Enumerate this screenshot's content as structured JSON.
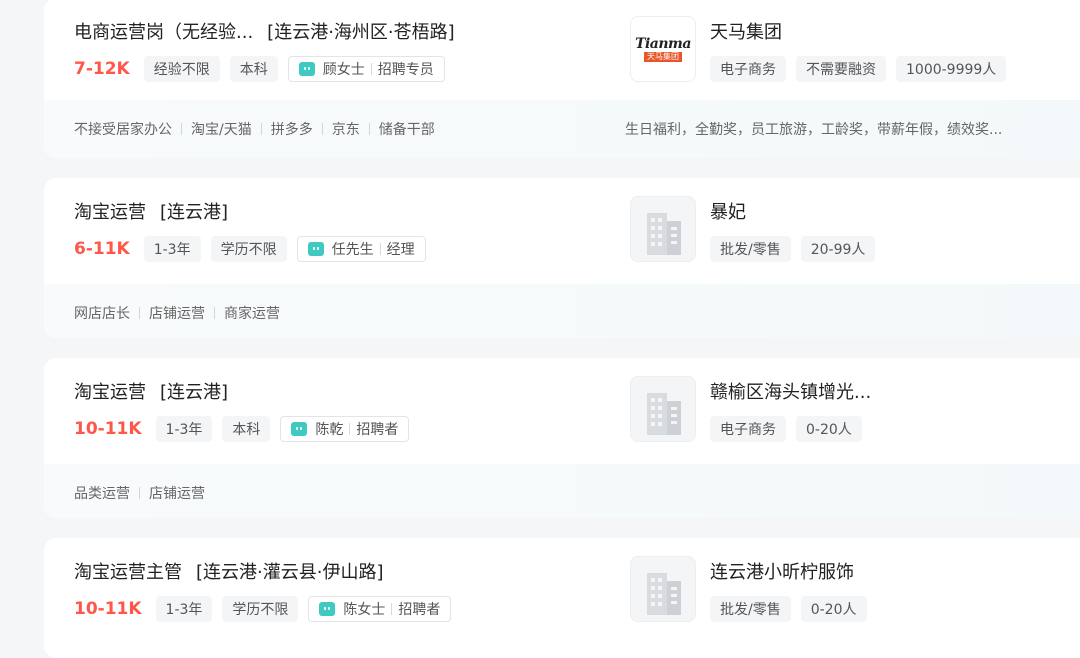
{
  "jobs": [
    {
      "title": "电商运营岗（无经验...",
      "area": "[连云港·海州区·苍梧路]",
      "salary": "7-12K",
      "tags": [
        "经验不限",
        "本科"
      ],
      "recruiter": {
        "name": "顾女士",
        "role": "招聘专员"
      },
      "company": {
        "name": "天马集团",
        "logo": "tianma-logo",
        "logo_text_en": "Tianma",
        "logo_text_cn": "天马集团",
        "tags": [
          "电子商务",
          "不需要融资",
          "1000-9999人"
        ]
      },
      "skills": [
        "不接受居家办公",
        "淘宝/天猫",
        "拼多多",
        "京东",
        "储备干部"
      ],
      "benefits": "生日福利，全勤奖，员工旅游，工龄奖，带薪年假，绩效奖..."
    },
    {
      "title": "淘宝运营",
      "area": "[连云港]",
      "salary": "6-11K",
      "tags": [
        "1-3年",
        "学历不限"
      ],
      "recruiter": {
        "name": "任先生",
        "role": "经理"
      },
      "company": {
        "name": "暴妃",
        "logo": "building-icon",
        "tags": [
          "批发/零售",
          "20-99人"
        ]
      },
      "skills": [
        "网店店长",
        "店铺运营",
        "商家运营"
      ],
      "benefits": ""
    },
    {
      "title": "淘宝运营",
      "area": "[连云港]",
      "salary": "10-11K",
      "tags": [
        "1-3年",
        "本科"
      ],
      "recruiter": {
        "name": "陈乾",
        "role": "招聘者"
      },
      "company": {
        "name": "赣榆区海头镇增光...",
        "logo": "building-icon",
        "tags": [
          "电子商务",
          "0-20人"
        ]
      },
      "skills": [
        "品类运营",
        "店铺运营"
      ],
      "benefits": ""
    },
    {
      "title": "淘宝运营主管",
      "area": "[连云港·灌云县·伊山路]",
      "salary": "10-11K",
      "tags": [
        "1-3年",
        "学历不限"
      ],
      "recruiter": {
        "name": "陈女士",
        "role": "招聘者"
      },
      "company": {
        "name": "连云港小昕柠服饰",
        "logo": "building-icon",
        "tags": [
          "批发/零售",
          "0-20人"
        ]
      },
      "skills": [],
      "benefits": ""
    }
  ],
  "colors": {
    "salary": "#fe574a",
    "chat": "#3ec9c1",
    "background": "#f5f6f8"
  }
}
